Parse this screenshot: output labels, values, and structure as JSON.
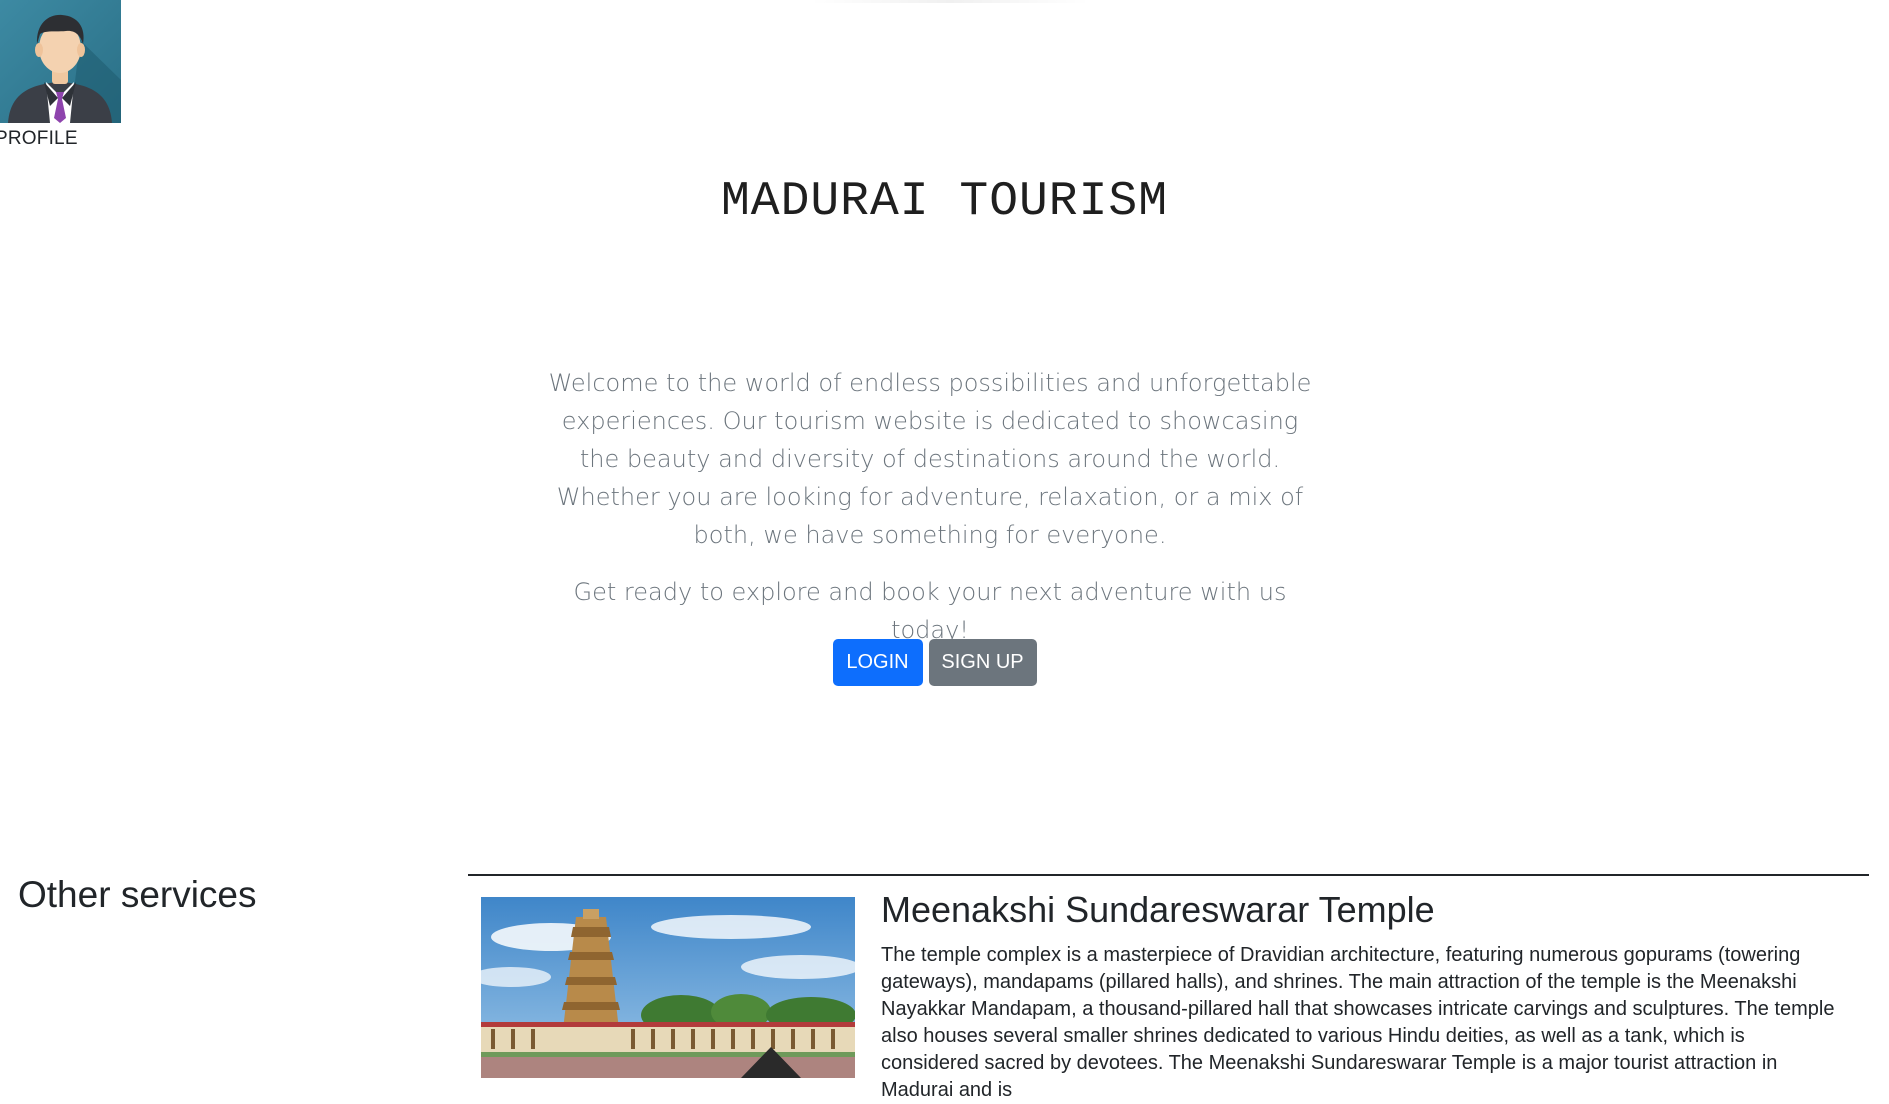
{
  "profile": {
    "label": "PROFILE",
    "icon": "avatar-icon"
  },
  "hero": {
    "title": "MADURAI TOURISM",
    "lead": "Welcome to the world of endless possibilities and unforgettable experiences. Our tourism website is dedicated to showcasing the beauty and diversity of destinations around the world. Whether you are looking for adventure, relaxation, or a mix of both, we have something for everyone.",
    "cta_text": "Get ready to explore and book your next adventure with us today!",
    "login_label": "LOGIN",
    "signup_label": "SIGN UP"
  },
  "services": {
    "heading": "Other services"
  },
  "featured": {
    "title": "Meenakshi Sundareswarar Temple",
    "description": "The temple complex is a masterpiece of Dravidian architecture, featuring numerous gopurams (towering gateways), mandapams (pillared halls), and shrines. The main attraction of the temple is the Meenakshi Nayakkar Mandapam, a thousand-pillared hall that showcases intricate carvings and sculptures. The temple also houses several smaller shrines dedicated to various Hindu deities, as well as a tank, which is considered sacred by devotees. The Meenakshi Sundareswarar Temple is a major tourist attraction in Madurai and is"
  },
  "colors": {
    "primary": "#0d6efd",
    "secondary": "#6c757d",
    "muted_text": "#6c757d",
    "divider": "#212529"
  }
}
